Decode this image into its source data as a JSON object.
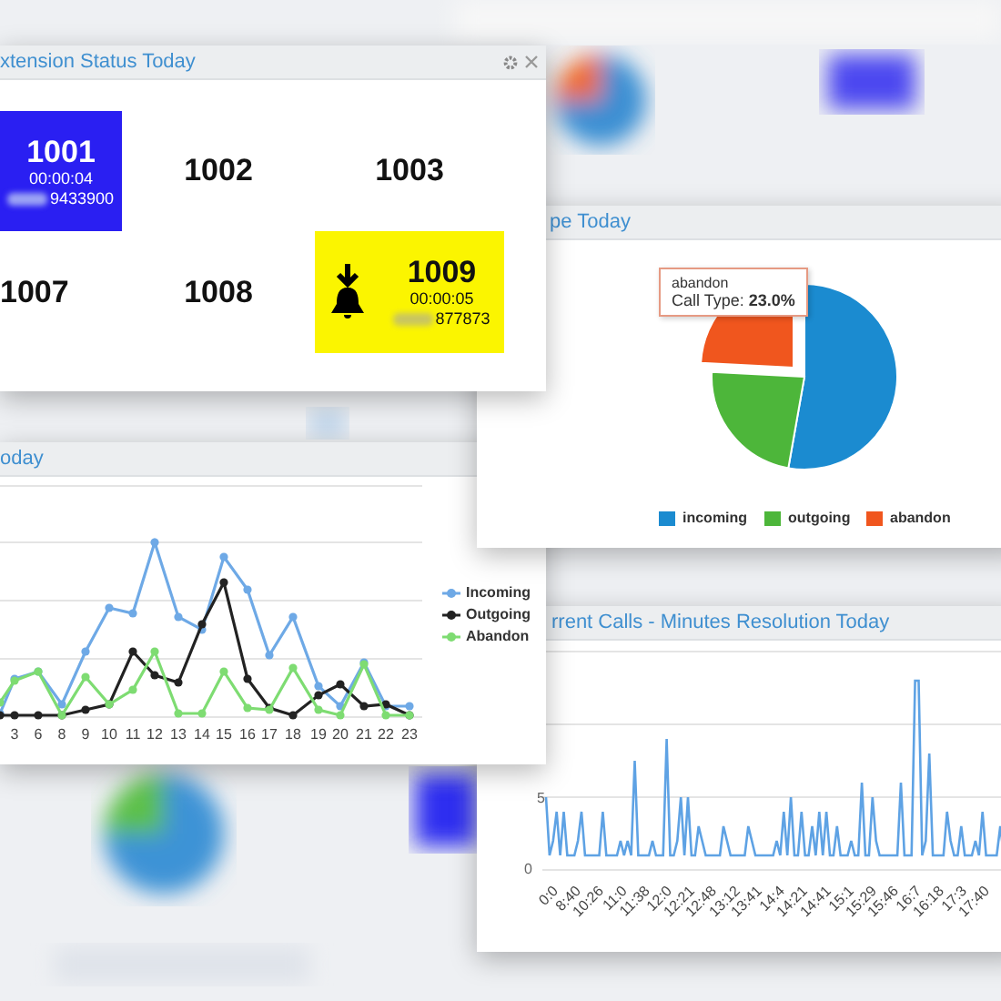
{
  "extension_panel": {
    "title": "xtension Status Today",
    "extensions": [
      {
        "number": "1001",
        "kind": "busy",
        "time": "00:00:04",
        "caller": "9433900"
      },
      {
        "number": "1002",
        "kind": "idle"
      },
      {
        "number": "1003",
        "kind": "idle"
      },
      {
        "number": "1007",
        "kind": "idle"
      },
      {
        "number": "1008",
        "kind": "idle"
      },
      {
        "number": "1009",
        "kind": "ringing",
        "time": "00:00:05",
        "caller": "877873"
      }
    ]
  },
  "call_type_panel": {
    "title": "pe Today",
    "tooltip": {
      "label": "abandon",
      "text": "Call Type: **23.0%**"
    },
    "legend": [
      {
        "label": "incoming",
        "color": "#1b8bd0"
      },
      {
        "label": "outgoing",
        "color": "#4db63a"
      },
      {
        "label": "abandon",
        "color": "#f0561e"
      }
    ]
  },
  "hourly_panel": {
    "title": "oday",
    "x_labels": [
      "3",
      "6",
      "8",
      "9",
      "10",
      "11",
      "12",
      "13",
      "14",
      "15",
      "16",
      "17",
      "18",
      "19",
      "20",
      "21",
      "22",
      "23"
    ],
    "legend": [
      {
        "label": "Incoming",
        "color": "#6ea9e6"
      },
      {
        "label": "Outgoing",
        "color": "#222222"
      },
      {
        "label": "Abandon",
        "color": "#7edc72"
      }
    ]
  },
  "concurrent_panel": {
    "title": "rrent Calls - Minutes Resolution Today",
    "y_labels": [
      "5",
      "0"
    ],
    "x_labels": [
      "0:0",
      "8:40",
      "10:26",
      "11:0",
      "11:38",
      "12:0",
      "12:21",
      "12:48",
      "13:12",
      "13:41",
      "14:4",
      "14:21",
      "14:41",
      "15:1",
      "15:29",
      "15:46",
      "16:7",
      "16:18",
      "17:3",
      "17:40"
    ]
  }
}
